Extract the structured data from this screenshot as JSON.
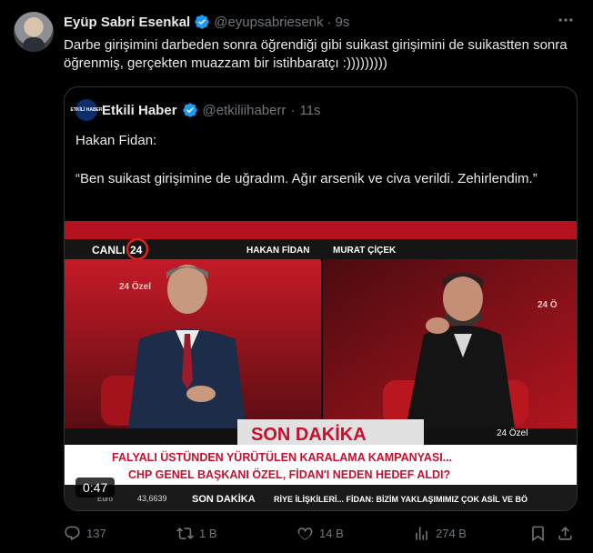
{
  "tweet": {
    "author_name": "Eyüp Sabri Esenkal",
    "handle": "@eyupsabriesenk",
    "separator": "·",
    "time": "9s",
    "text": "Darbe girişimini darbeden sonra öğrendiği gibi suikast girişimini de suikastten sonra öğrenmiş, gerçekten muazzam bir istihbaratçı :)))))))))",
    "more_icon": "more-icon"
  },
  "quote": {
    "avatar_text": "ETKİLİ HABER",
    "author_name": "Etkili Haber",
    "handle": "@etkiliihaberr",
    "separator": "·",
    "time": "11s",
    "line1": "Hakan Fidan:",
    "line2": "“Ben suikast girişimine de uğradım. Ağır arsenik ve civa verildi. Zehirlendim.”",
    "video": {
      "duration": "0:47",
      "live_label": "CANLI",
      "channel": "24",
      "guest1": "HAKAN FİDAN",
      "guest2": "MURAT ÇİÇEK",
      "program_left": "24 Özel",
      "program_right": "24 Ö",
      "program_tag": "24 Özel",
      "breaking": "SON DAKİKA",
      "headline1": "FALYALI ÜSTÜNDEN YÜRÜTÜLEN KARALAMA KAMPANYASI...",
      "headline2": "CHP GENEL BAŞKANI ÖZEL, FİDAN'I NEDEN HEDEF ALDI?",
      "ticker_currency": "Euro",
      "ticker_value": "43,6639",
      "ticker_label": "SON DAKİKA",
      "ticker_text": "RİYE İLİŞKİLERİ... FİDAN: BİZİM YAKLAŞIMIMIZ ÇOK ASİL VE BÖ"
    }
  },
  "actions": {
    "replies": "137",
    "reposts": "1 B",
    "likes": "14 B",
    "views": "274 B"
  },
  "colors": {
    "background": "#000000",
    "text": "#e7e9ea",
    "muted": "#71767b",
    "border": "#2f3336",
    "verified": "#1d9bf0",
    "broadcast_red": "#c8102e"
  }
}
